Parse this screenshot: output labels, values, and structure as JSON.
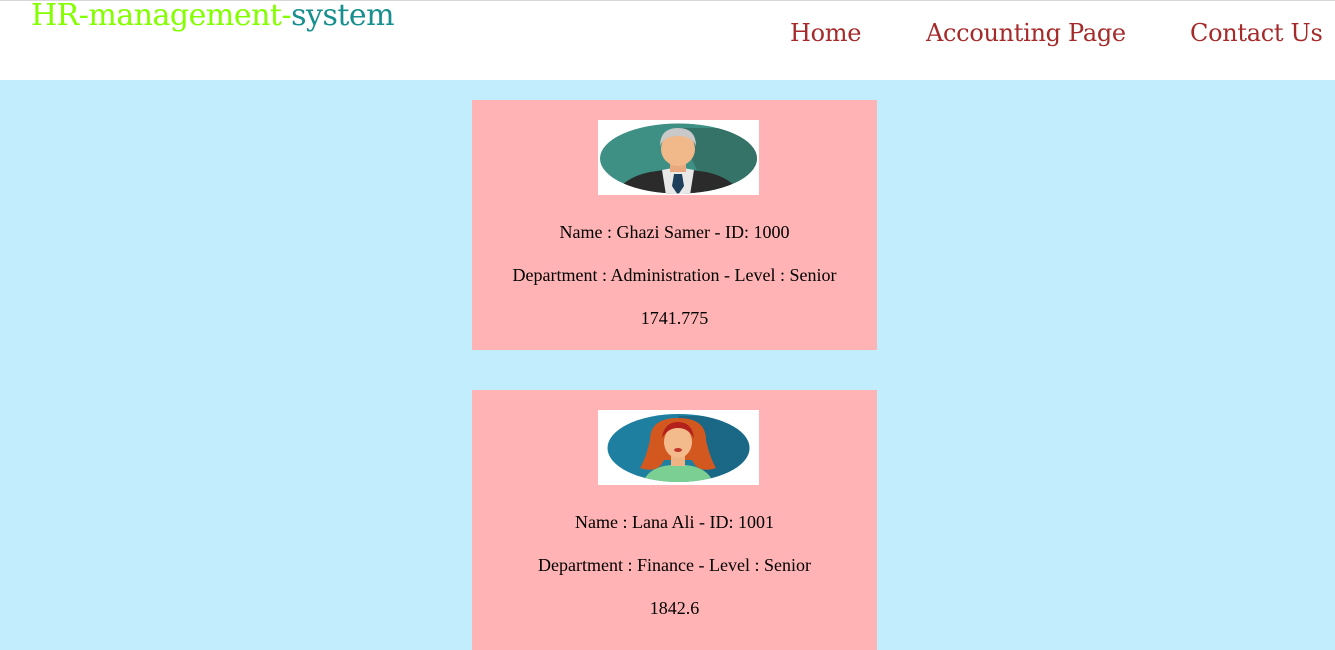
{
  "header": {
    "logo_part1": "HR-management-",
    "logo_part2": "system",
    "nav": [
      {
        "label": "Home"
      },
      {
        "label": "Accounting Page"
      },
      {
        "label": "Contact Us"
      }
    ]
  },
  "employees": [
    {
      "avatar": "male-employee-icon",
      "name_line": "Name : Ghazi Samer - ID: 1000",
      "dept_line": "Department : Administration - Level : Senior",
      "salary": "1741.775"
    },
    {
      "avatar": "female-employee-icon",
      "name_line": "Name : Lana Ali - ID: 1001",
      "dept_line": "Department : Finance - Level : Senior",
      "salary": "1842.6"
    }
  ],
  "colors": {
    "page_background": "#c1edfc",
    "card_background": "#ffb3b4",
    "logo_green": "#84ff00",
    "logo_teal": "#178f8f",
    "nav_link": "#a52a2a"
  }
}
